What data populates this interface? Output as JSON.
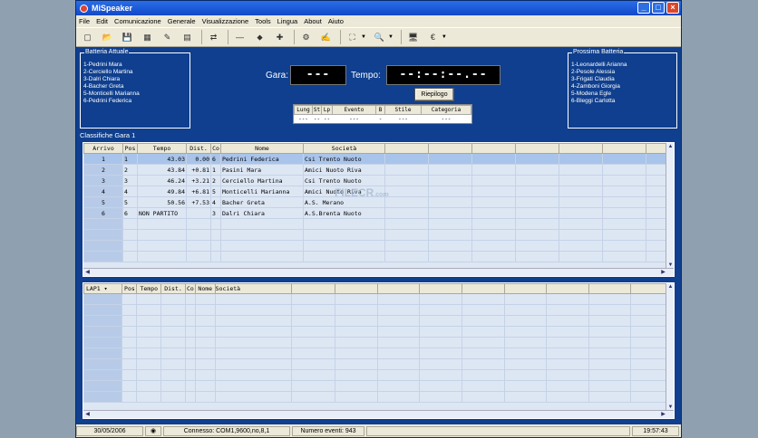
{
  "window": {
    "title": "MiSpeaker",
    "min": "_",
    "max": "□",
    "close": "×"
  },
  "menu": [
    "File",
    "Edit",
    "Comunicazione",
    "Generale",
    "Visualizzazione",
    "Tools",
    "Lingua",
    "About",
    "Aiuto"
  ],
  "toolbar": {
    "icons": [
      "new-icon",
      "open-icon",
      "save-icon",
      "properties-icon",
      "tools-icon",
      "document-icon",
      "export-icon",
      "minus-icon",
      "diamond-icon",
      "plus-icon",
      "settings-icon",
      "edit-icon",
      "binoculars-icon",
      "preview-icon",
      "computer-icon",
      "currency-icon"
    ],
    "glyphs": [
      "▢",
      "📂",
      "💾",
      "▦",
      "✎",
      "▤",
      "⇄",
      "—",
      "⬥",
      "✚",
      "⚙",
      "✍",
      "⛶",
      "🔍",
      "🖥",
      "€"
    ]
  },
  "batteria_attuale": {
    "caption": "Batteria Attuale",
    "items": [
      "1-Pedrini Mara",
      "2-Cerciello Martina",
      "3-Dalri Chiara",
      "4-Bacher Greta",
      "5-Monticelli Marianna",
      "6-Pedrini Federica"
    ]
  },
  "prossima_batteria": {
    "caption": "Prossima Batteria",
    "items": [
      "1-Leonardelli Arianna",
      "2-Pesole Alessia",
      "3-Frigati Claudia",
      "4-Zamboni Giorgia",
      "5-Modena Egle",
      "6-Bleggi Carlotta"
    ]
  },
  "gara": {
    "label": "Gara:",
    "value": "---"
  },
  "tempo": {
    "label": "Tempo:",
    "value": "--:--:--.--"
  },
  "riepilogo_label": "Riepilogo",
  "evento": {
    "headers": [
      "Lung",
      "St",
      "Lp",
      "Evento",
      "B",
      "Stile",
      "Categoria"
    ],
    "row": [
      "---",
      "--",
      "--",
      "---",
      "-",
      "---",
      "---"
    ]
  },
  "classifiche": {
    "caption": "Classifiche Gara 1",
    "headers": [
      "Arrivo",
      "Pos",
      "Tempo",
      "Dist.",
      "Co",
      "Nome",
      "Società"
    ],
    "rows": [
      [
        "1",
        "1",
        "43.03",
        "0.00",
        "6",
        "Pedrini Federica",
        "Csi Trento Nuoto"
      ],
      [
        "2",
        "2",
        "43.84",
        "+0.81",
        "1",
        "Pasini Mara",
        "Amici Nuoto  Riva"
      ],
      [
        "3",
        "3",
        "46.24",
        "+3.21",
        "2",
        "Cerciello Martina",
        "Csi Trento Nuoto"
      ],
      [
        "4",
        "4",
        "49.84",
        "+6.81",
        "5",
        "Monticelli Marianna",
        "Amici Nuoto  Riva"
      ],
      [
        "5",
        "5",
        "50.56",
        "+7.53",
        "4",
        "Bacher Greta",
        "A.S. Merano"
      ],
      [
        "6",
        "6",
        "NON PARTITO",
        "",
        "3",
        "Dalri Chiara",
        "A.S.Brenta Nuoto"
      ]
    ]
  },
  "lap": {
    "select": "LAP1",
    "headers": [
      "Pos",
      "Tempo",
      "Dist.",
      "Co",
      "Nome",
      "Società"
    ]
  },
  "status": {
    "date": "30/05/2006",
    "connection": "Connesso: COM1,9600,no,8,1",
    "events": "Numero eventi: 943",
    "time": "19:57:43"
  },
  "watermark": "FILECR",
  "watermark_sub": ".com"
}
